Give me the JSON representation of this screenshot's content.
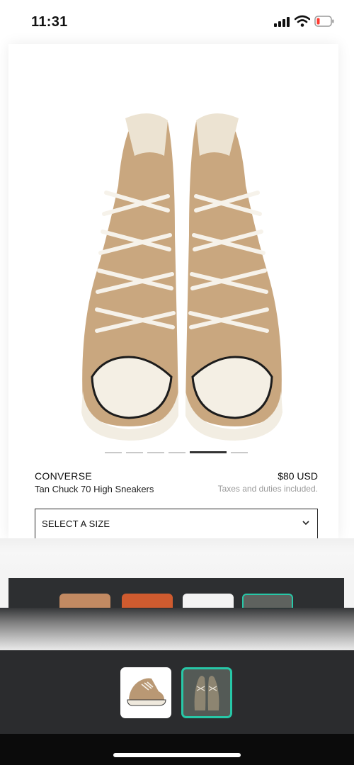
{
  "status_bar": {
    "time": "11:31"
  },
  "product": {
    "brand": "CONVERSE",
    "name": "Tan Chuck 70 High Sneakers",
    "price": "$80 USD",
    "tax_note": "Taxes and duties included.",
    "image_index": 5,
    "image_count": 6
  },
  "size_select": {
    "label": "SELECT A SIZE"
  },
  "colors": {
    "accent": "#27c7a7",
    "tray_background": "#2b2c2e",
    "shoe_tan": "#c9a77f"
  },
  "thumbnails": [
    {
      "name": "tan-sneaker-side-view",
      "selected": false
    },
    {
      "name": "sneakers-top-view",
      "selected": true
    }
  ]
}
